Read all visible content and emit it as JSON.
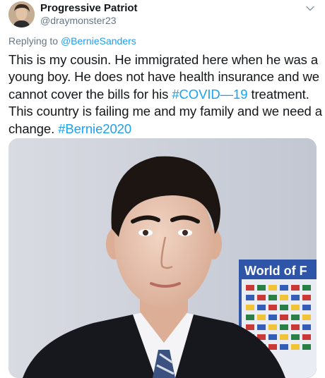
{
  "author": {
    "display_name": "Progressive Patriot",
    "handle": "@draymonster23"
  },
  "reply_context": {
    "prefix": "Replying to ",
    "mention": "@BernieSanders"
  },
  "tweet_text": {
    "line1": "This is my cousin. He immigrated here when he was a",
    "line2": "young boy.  He does not have health insurance and we",
    "line3_before": "cannot cover the bills for his ",
    "line3_tag": "#COVID—19",
    "line3_after": " treatment.",
    "line4": "This country is failing me and my family and we need a",
    "line5_before": "change. ",
    "line5_tag": "#Bernie2020"
  },
  "media": {
    "poster_text": "World of F"
  },
  "icons": {
    "menu": "chevron-down-icon"
  },
  "colors": {
    "link": "#1da1f2",
    "text": "#14171a",
    "muted": "#657786"
  }
}
